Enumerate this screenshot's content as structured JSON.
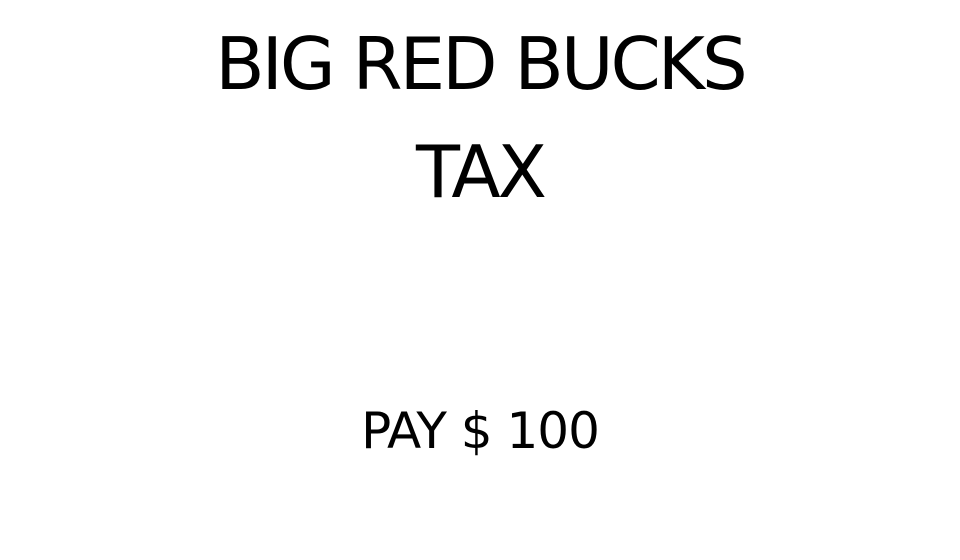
{
  "card": {
    "title_line1": "BIG RED BUCKS",
    "title_line2": "TAX",
    "amount_text": "PAY $ 100"
  },
  "colors": {
    "background": "#ffffff",
    "text": "#000000"
  }
}
